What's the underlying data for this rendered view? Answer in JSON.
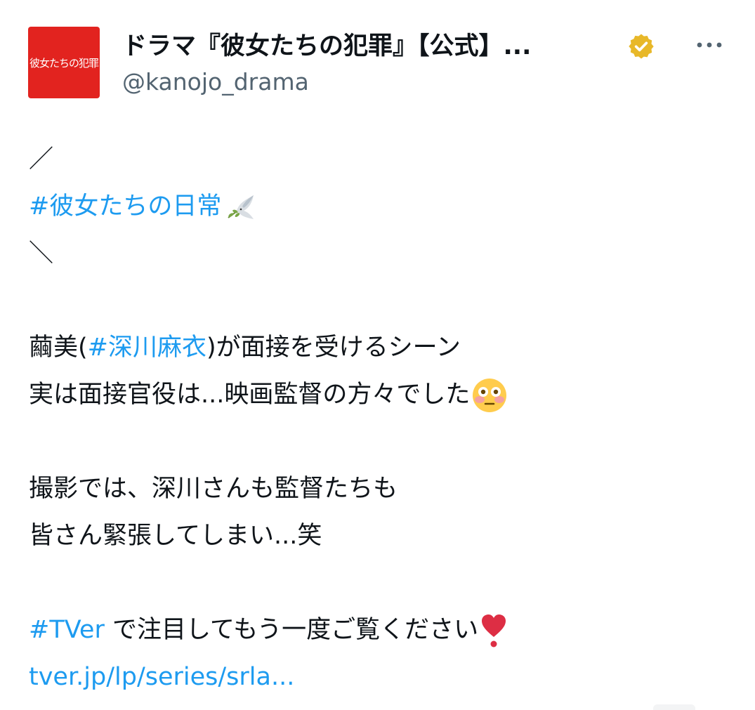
{
  "account": {
    "avatar_text": "彼女たちの犯罪",
    "display_name": "ドラマ『彼女たちの犯罪』【公式】...",
    "handle": "@kanojo_drama",
    "verified": true,
    "avatar_color": "#e2231f",
    "badge_color": "#e8b829"
  },
  "tweet": {
    "slash_top": "／",
    "hashtag_daily": "#彼女たちの日常",
    "emoji_dove": "dove-icon",
    "slash_bottom": "＼",
    "line1_prefix": "繭美(",
    "hashtag_actor": "#深川麻衣",
    "line1_suffix": ")が面接を受けるシーン",
    "line2": "実は面接官役は...映画監督の方々でした",
    "emoji_flushed": "flushed-face-icon",
    "line3": "撮影では、深川さんも監督たちも",
    "line4": "皆さん緊張してしまい...笑",
    "hashtag_tver": "#TVer",
    "line5_suffix": " で注目してもう一度ご覧ください",
    "emoji_heart": "heart-exclamation-icon",
    "link_text": "tver.jp/lp/series/srla..."
  },
  "colors": {
    "link": "#1d9bf0",
    "text": "#0f1419",
    "secondary": "#536471"
  }
}
